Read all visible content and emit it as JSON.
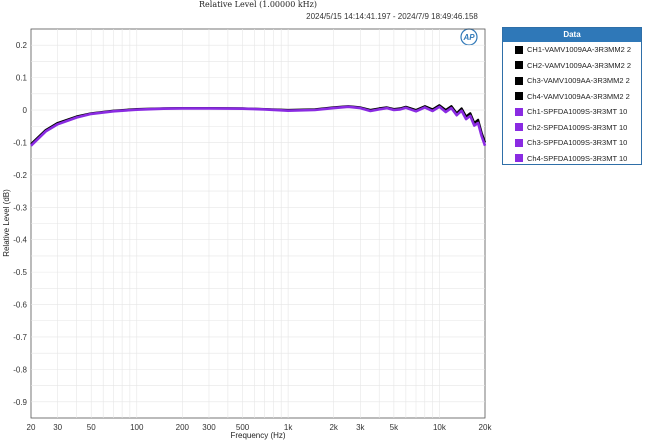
{
  "chart_data": {
    "type": "line",
    "title": "Relative Level (1.00000 kHz)",
    "subtitle": "2024/5/15 14:14:41.197 - 2024/7/9 18:49:46.158",
    "xlabel": "Frequency (Hz)",
    "ylabel": "Relative Level (dB)",
    "xscale": "log",
    "xlim": [
      20,
      20000
    ],
    "ylim": [
      -0.95,
      0.25
    ],
    "xticks": [
      20,
      30,
      50,
      100,
      200,
      300,
      500,
      1000,
      2000,
      3000,
      5000,
      10000,
      20000
    ],
    "xtick_labels": [
      "20",
      "30",
      "50",
      "100",
      "200",
      "300",
      "500",
      "1k",
      "2k",
      "3k",
      "5k",
      "10k",
      "20k"
    ],
    "yticks": [
      0.2,
      0.1,
      0,
      -0.1,
      -0.2,
      -0.3,
      -0.4,
      -0.5,
      -0.6,
      -0.7,
      -0.8,
      -0.9
    ],
    "ytick_labels": [
      "0.2",
      "0.1",
      "0",
      "-0.1",
      "-0.2",
      "-0.3",
      "-0.4",
      "-0.5",
      "-0.6",
      "-0.7",
      "-0.8",
      "-0.9"
    ],
    "grid": true,
    "legend": {
      "title": "Data",
      "placement": "top-right",
      "entries": [
        {
          "label": "CH1-VAMV1009AA-3R3MM2 2",
          "color": "#000000"
        },
        {
          "label": "CH2-VAMV1009AA-3R3MM2 2",
          "color": "#000000"
        },
        {
          "label": "Ch3-VAMV1009AA-3R3MM2 2",
          "color": "#000000"
        },
        {
          "label": "Ch4-VAMV1009AA-3R3MM2 2",
          "color": "#000000"
        },
        {
          "label": "Ch1-SPFDA1009S-3R3MT 10",
          "color": "#8a2be2"
        },
        {
          "label": "Ch2-SPFDA1009S-3R3MT 10",
          "color": "#8a2be2"
        },
        {
          "label": "Ch3-SPFDA1009S-3R3MT 10",
          "color": "#8a2be2"
        },
        {
          "label": "Ch4-SPFDA1009S-3R3MT 10",
          "color": "#8a2be2"
        }
      ]
    },
    "series": [
      {
        "color": "#000000",
        "x": [
          20,
          25,
          30,
          40,
          50,
          70,
          100,
          150,
          200,
          300,
          500,
          700,
          1000,
          1500,
          2000,
          2500,
          3000,
          3500,
          4000,
          4500,
          5000,
          5500,
          6000,
          7000,
          8000,
          9000,
          10000,
          11000,
          12000,
          13000,
          14000,
          15000,
          16000,
          17000,
          18000,
          19000,
          20000
        ],
        "y": [
          -0.105,
          -0.062,
          -0.04,
          -0.02,
          -0.01,
          -0.002,
          0.003,
          0.005,
          0.006,
          0.006,
          0.005,
          0.003,
          0.0,
          0.002,
          0.008,
          0.012,
          0.008,
          0.0,
          0.005,
          0.008,
          0.003,
          0.005,
          0.01,
          0.0,
          0.012,
          0.002,
          0.015,
          0.0,
          0.012,
          -0.01,
          0.005,
          -0.02,
          -0.01,
          -0.04,
          -0.03,
          -0.07,
          -0.1
        ]
      },
      {
        "color": "#8a2be2",
        "x": [
          20,
          25,
          30,
          40,
          50,
          70,
          100,
          150,
          200,
          300,
          500,
          700,
          1000,
          1500,
          2000,
          2500,
          3000,
          3500,
          4000,
          4500,
          5000,
          5500,
          6000,
          7000,
          8000,
          9000,
          10000,
          11000,
          12000,
          13000,
          14000,
          15000,
          16000,
          17000,
          18000,
          19000,
          20000
        ],
        "y": [
          -0.11,
          -0.066,
          -0.044,
          -0.023,
          -0.012,
          -0.004,
          0.001,
          0.004,
          0.005,
          0.005,
          0.004,
          0.002,
          -0.002,
          0.0,
          0.006,
          0.01,
          0.006,
          -0.003,
          0.002,
          0.006,
          0.0,
          0.002,
          0.007,
          -0.004,
          0.008,
          -0.003,
          0.01,
          -0.006,
          0.006,
          -0.016,
          -0.002,
          -0.028,
          -0.018,
          -0.048,
          -0.04,
          -0.08,
          -0.11
        ]
      }
    ]
  }
}
